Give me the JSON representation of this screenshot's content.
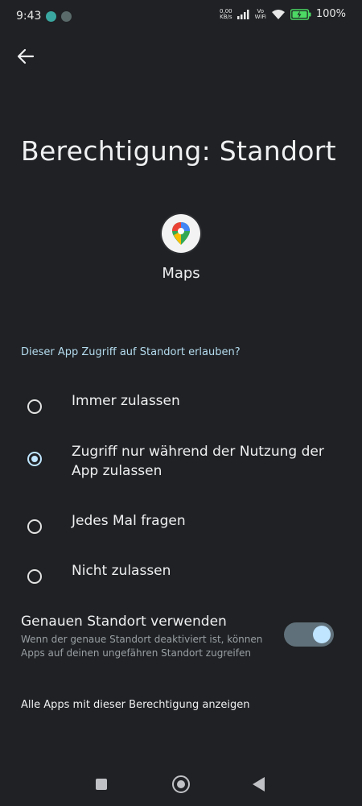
{
  "status_bar": {
    "time": "9:43",
    "data_rate": "0,00",
    "data_unit": "KB/s",
    "vo": "Vo",
    "wifi_label": "WiFi",
    "battery": "100%"
  },
  "header": {
    "title": "Berechtigung: Standort"
  },
  "app": {
    "name": "Maps"
  },
  "permission": {
    "question": "Dieser App Zugriff auf Standort erlauben?",
    "options": [
      {
        "label": "Immer zulassen",
        "selected": false
      },
      {
        "label": "Zugriff nur während der Nutzung der App zulassen",
        "selected": true
      },
      {
        "label": "Jedes Mal fragen",
        "selected": false
      },
      {
        "label": "Nicht zulassen",
        "selected": false
      }
    ]
  },
  "precise": {
    "title": "Genauen Standort verwenden",
    "description": "Wenn der genaue Standort deaktiviert ist, können Apps auf deinen ungefähren Standort zugreifen",
    "enabled": true
  },
  "footer": {
    "all_apps_link": "Alle Apps mit dieser Berechtigung anzeigen"
  },
  "colors": {
    "background": "#1f2124",
    "accent": "#bfe5ff",
    "question": "#b4dbee"
  }
}
